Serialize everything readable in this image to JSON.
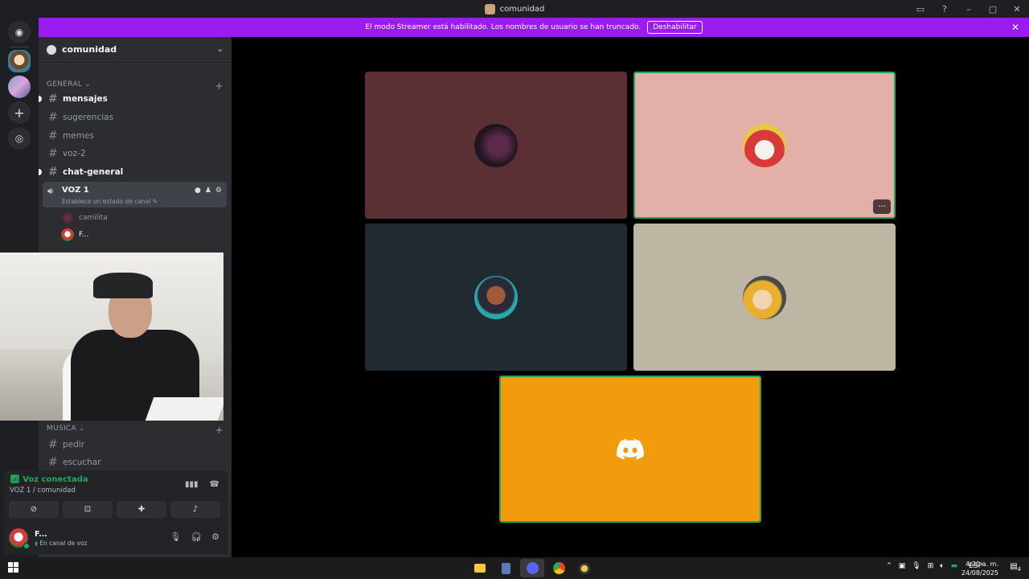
{
  "window": {
    "title": "comunidad"
  },
  "banner": {
    "text": "El modo Streamer está habilitado. Los nombres de usuario se han truncado.",
    "button_label": "Deshabilitar",
    "color": "#9b1cf0"
  },
  "guild": {
    "name": "comunidad"
  },
  "categories": [
    {
      "name": "GENERAL"
    },
    {
      "name": "MUSICA"
    }
  ],
  "general_channels": [
    {
      "name": "mensajes",
      "unread": true
    },
    {
      "name": "sugerencias",
      "unread": false
    },
    {
      "name": "memes",
      "unread": false
    },
    {
      "name": "voz-2",
      "unread": false
    },
    {
      "name": "chat-general",
      "unread": true
    }
  ],
  "voice_channel": {
    "name": "VOZ 1",
    "status_placeholder": "Establece un estado de canal",
    "users": [
      {
        "name": "camilita"
      },
      {
        "name": "F..."
      }
    ]
  },
  "music_channels": [
    {
      "name": "pedir"
    },
    {
      "name": "escuchar"
    }
  ],
  "voice_panel": {
    "title": "Voz conectada",
    "subtitle": "VOZ 1 / comunidad",
    "status_color": "#23a55a"
  },
  "user": {
    "name": "F...",
    "status": "En canal de voz"
  },
  "tiles": [
    {
      "bg": "#5a3034",
      "speaking": false
    },
    {
      "bg": "#e2b0a8",
      "speaking": true
    },
    {
      "bg": "#222a31",
      "speaking": false
    },
    {
      "bg": "#bdb6a2",
      "speaking": false
    },
    {
      "bg": "#f29b0c",
      "speaking": true
    }
  ],
  "taskbar": {
    "language": "ESP",
    "time": "4:20 a. m.",
    "date": "24/08/2025",
    "notifications": "4"
  }
}
